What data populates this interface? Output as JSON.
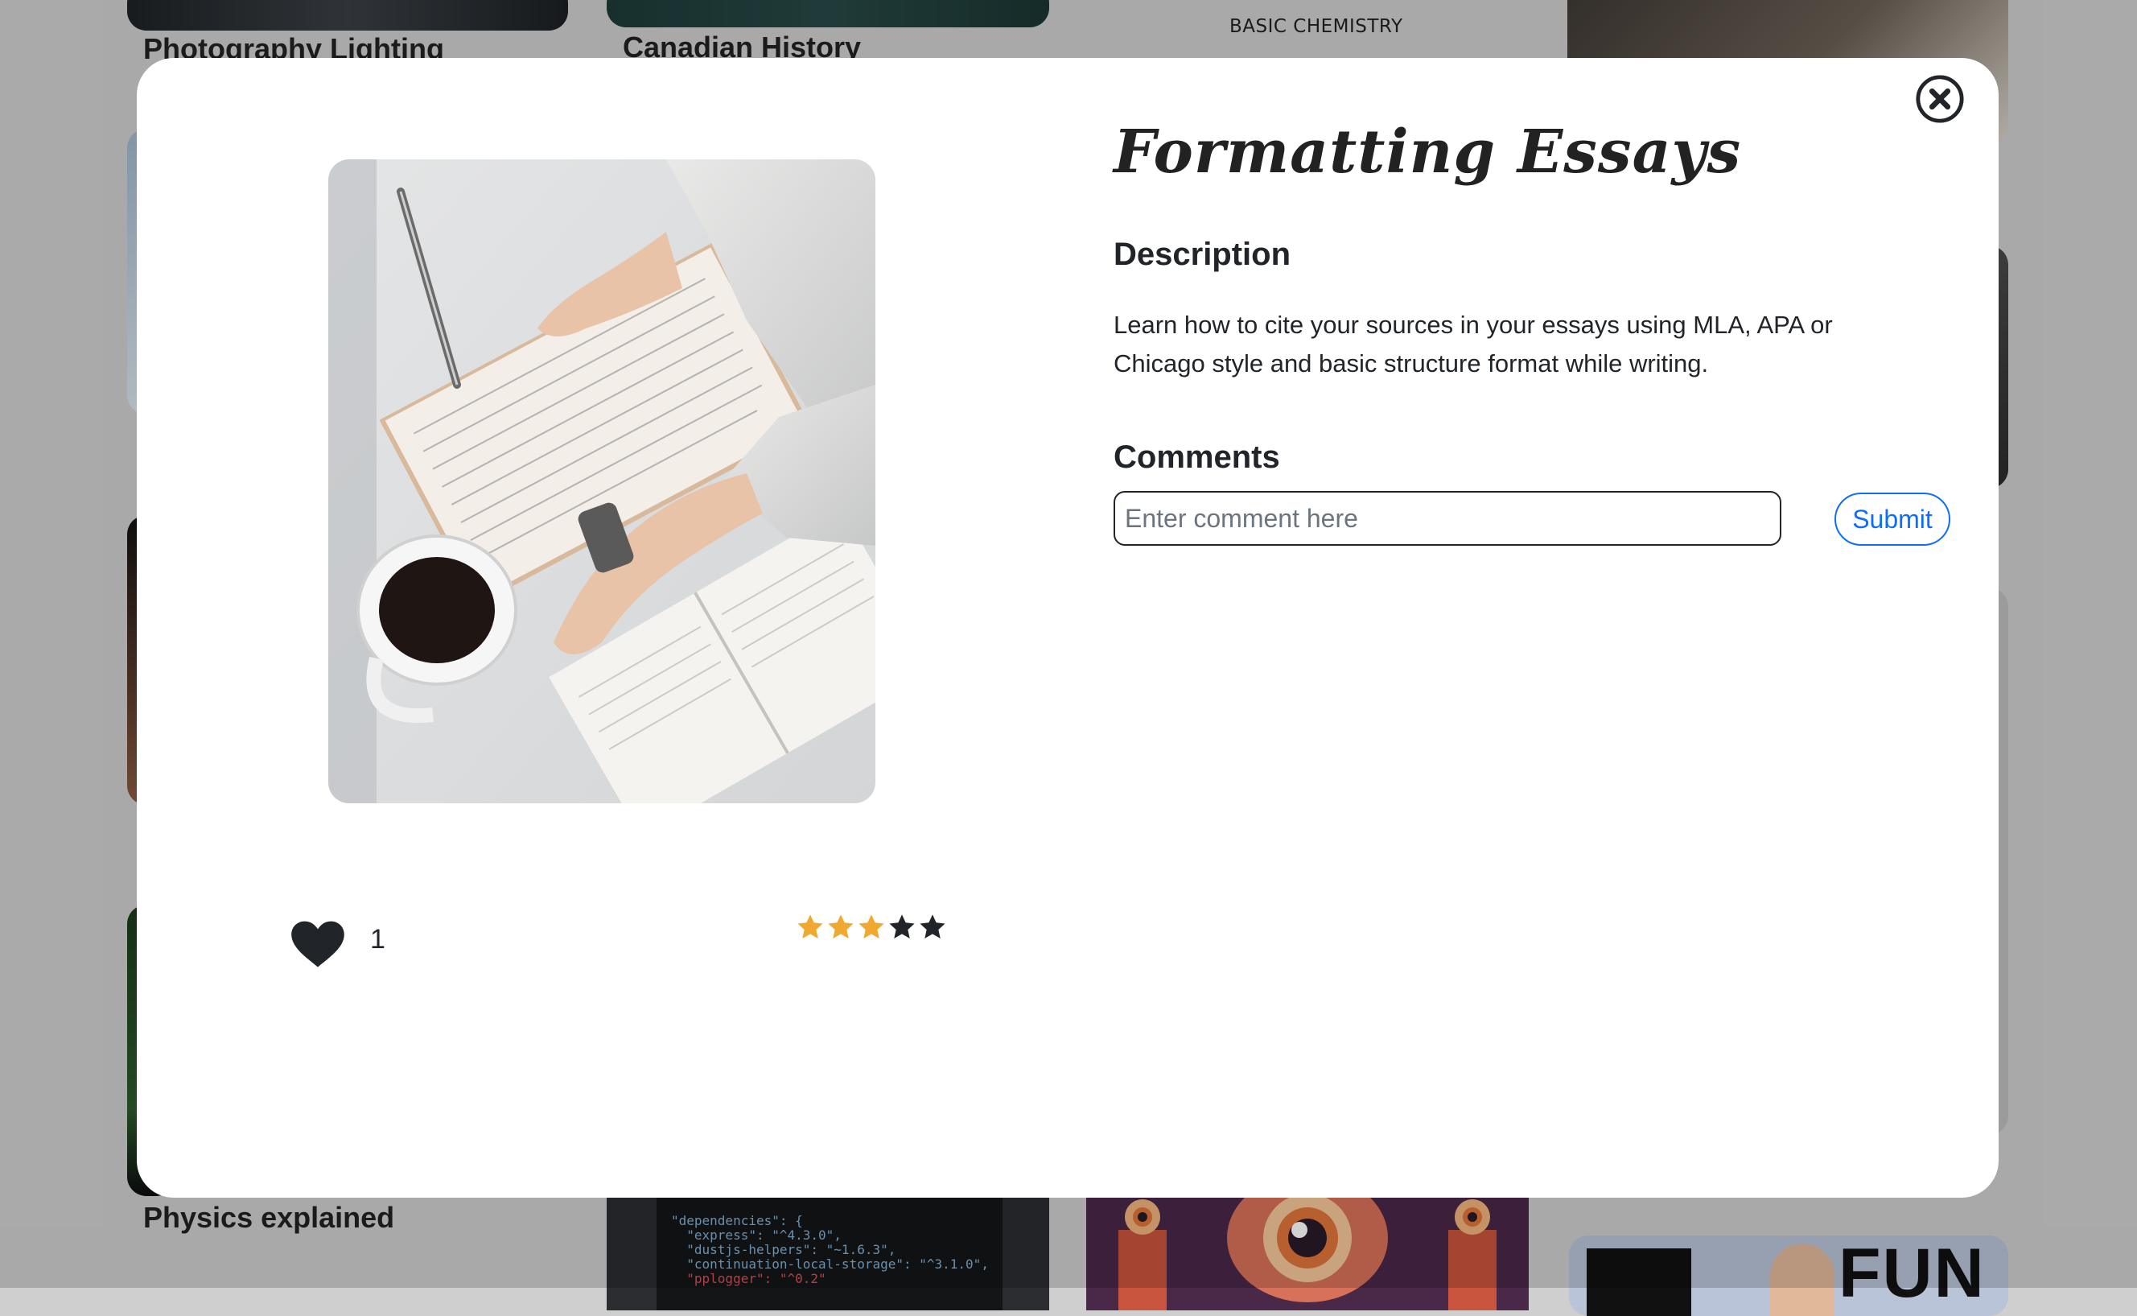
{
  "background": {
    "cards": [
      {
        "title": "Photography Lighting"
      },
      {
        "title": "Canadian History"
      },
      {
        "subtitle": "BASIC CHEMISTRY"
      },
      {
        "title": "Physics explained"
      },
      {
        "banner_text": "FUN"
      }
    ],
    "code_lines": [
      "\"dependencies\": {",
      "  \"express\": \"^4.3.0\",",
      "  \"dustjs-helpers\": \"~1.6.3\",",
      "  \"continuation-local-storage\": \"^3.1.0\",",
      "  \"pplogger\": \"^0.2\""
    ]
  },
  "modal": {
    "title": "Formatting Essays",
    "description_heading": "Description",
    "description": "Learn how to cite your sources in your essays using MLA, APA or Chicago style and basic structure format while writing.",
    "comments_heading": "Comments",
    "comment_placeholder": "Enter comment here",
    "submit_label": "Submit",
    "likes": "1",
    "rating": {
      "value": 3,
      "max": 5,
      "filled_color": "#f0a830",
      "empty_color": "#212529"
    },
    "close_icon": "close-circle-icon",
    "like_icon": "heart-icon",
    "accent_color": "#0d6efd"
  }
}
